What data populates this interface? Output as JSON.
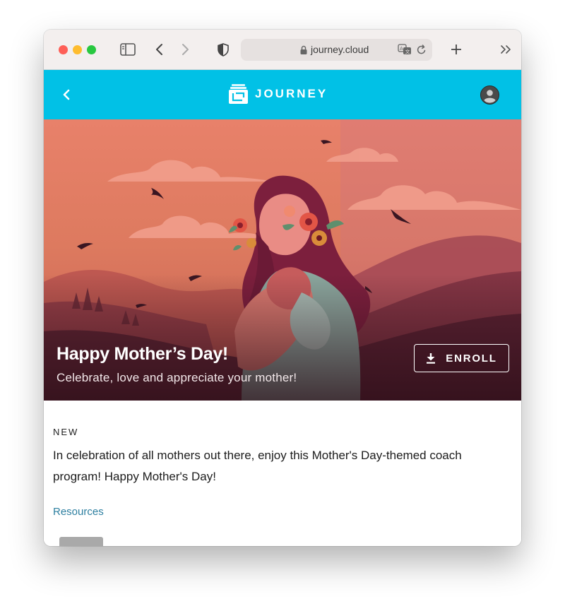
{
  "browser": {
    "url": "journey.cloud"
  },
  "header": {
    "brand_name": "JOURNEY",
    "back_icon": "chevron-left-icon",
    "avatar_icon": "user-avatar-icon"
  },
  "hero": {
    "title": "Happy Mother’s Day!",
    "subtitle": "Celebrate, love and appreciate your mother!",
    "enroll_label": "ENROLL",
    "enroll_icon": "download-icon"
  },
  "content": {
    "badge": "NEW",
    "description": "In celebration of all mothers out there, enjoy this Mother's Day-themed coach program! Happy Mother's Day!",
    "resources_label": "Resources"
  },
  "colors": {
    "header_bg": "#01c1e6",
    "link": "#2d7fa0"
  }
}
